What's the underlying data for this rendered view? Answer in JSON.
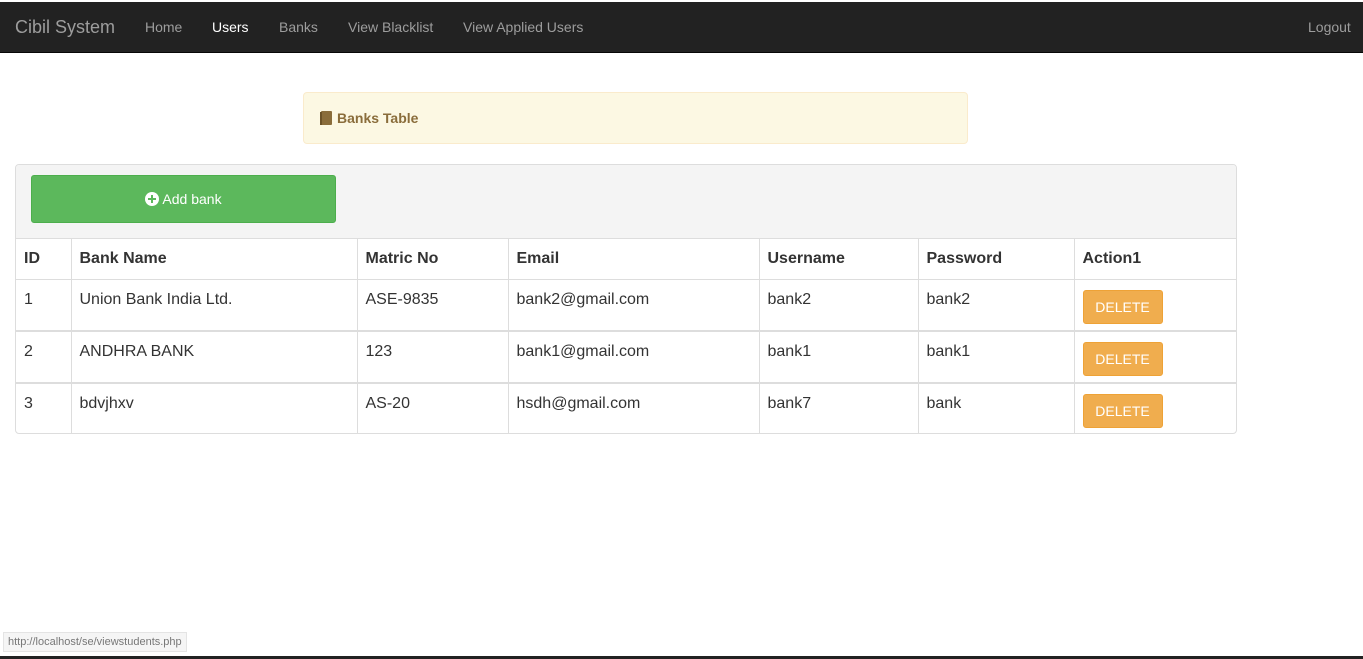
{
  "nav": {
    "brand": "Cibil System",
    "items": [
      {
        "label": "Home",
        "active": false
      },
      {
        "label": "Users",
        "active": true
      },
      {
        "label": "Banks",
        "active": false
      },
      {
        "label": "View Blacklist",
        "active": false
      },
      {
        "label": "View Applied Users",
        "active": false
      }
    ],
    "logout": "Logout"
  },
  "panel": {
    "title": "Banks Table",
    "icon": "book-icon"
  },
  "toolbar": {
    "add_label": "Add bank",
    "add_icon": "plus-circle-icon"
  },
  "table": {
    "headers": [
      "ID",
      "Bank Name",
      "Matric No",
      "Email",
      "Username",
      "Password",
      "Action1"
    ],
    "rows": [
      {
        "id": "1",
        "name": "Union Bank India Ltd.",
        "matric": "ASE-9835",
        "email": "bank2@gmail.com",
        "username": "bank2",
        "password": "bank2",
        "action": "DELETE"
      },
      {
        "id": "2",
        "name": "ANDHRA BANK",
        "matric": "123",
        "email": "bank1@gmail.com",
        "username": "bank1",
        "password": "bank1",
        "action": "DELETE"
      },
      {
        "id": "3",
        "name": "bdvjhxv",
        "matric": "AS-20",
        "email": "hsdh@gmail.com",
        "username": "bank7",
        "password": "bank",
        "action": "DELETE"
      }
    ]
  },
  "status_url": "http://localhost/se/viewstudents.php",
  "colors": {
    "navbar": "#222222",
    "success": "#5cb85c",
    "warning": "#f0ad4e",
    "panel_heading": "#fcf8e3"
  }
}
